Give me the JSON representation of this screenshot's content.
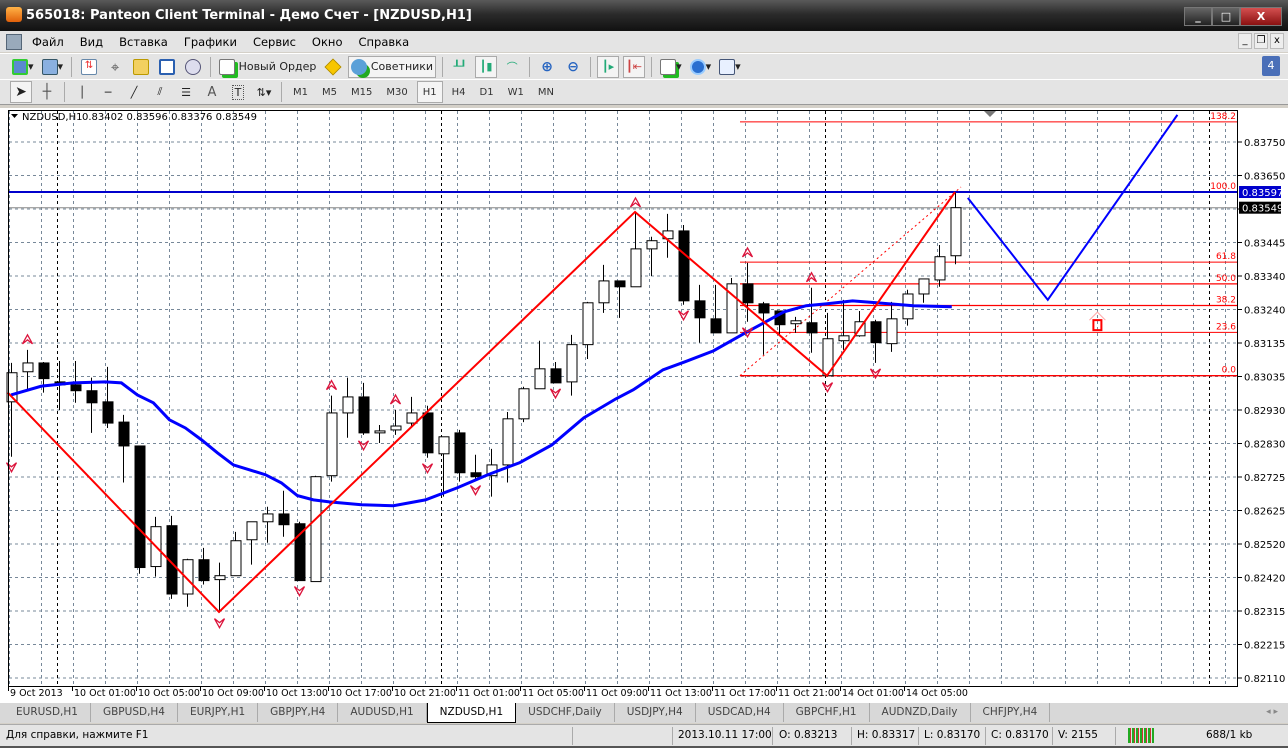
{
  "window": {
    "title": "565018: Panteon Client Terminal - Демо Счет - [NZDUSD,H1]",
    "minimize": "_",
    "maximize": "□",
    "close": "X"
  },
  "menu": [
    "Файл",
    "Вид",
    "Вставка",
    "Графики",
    "Сервис",
    "Окно",
    "Справка"
  ],
  "mdi": {
    "minimize": "_",
    "restore": "❐",
    "close": "x"
  },
  "toolbar": {
    "new_order": "Новый Ордер",
    "experts": "Советники",
    "notifications": "4"
  },
  "timeframes": [
    "M1",
    "M5",
    "M15",
    "M30",
    "H1",
    "H4",
    "D1",
    "W1",
    "MN"
  ],
  "active_timeframe": "H1",
  "chart_header": {
    "symbol": "NZDUSD,H1",
    "ohlc": "0.83402 0.83596 0.83376 0.83549"
  },
  "tabs": [
    "EURUSD,H1",
    "GBPUSD,H4",
    "EURJPY,H1",
    "GBPJPY,H4",
    "AUDUSD,H1",
    "NZDUSD,H1",
    "USDCHF,Daily",
    "USDJPY,H4",
    "USDCAD,H4",
    "GBPCHF,H1",
    "AUDNZD,Daily",
    "CHFJPY,H4"
  ],
  "active_tab": "NZDUSD,H1",
  "status": {
    "help": "Для справки, нажмите F1",
    "time": "2013.10.11 17:00",
    "open": "O: 0.83213",
    "high": "H: 0.83317",
    "low": "L: 0.83170",
    "close": "C: 0.83170",
    "volume": "V: 2155",
    "traffic": "688/1 kb"
  },
  "chart_data": {
    "type": "candlestick",
    "symbol": "NZDUSD",
    "timeframe": "H1",
    "ylim": [
      0.8211,
      0.8375
    ],
    "grid": true,
    "y_ticks": [
      "0.83750",
      "0.83650",
      "",
      "0.83445",
      "0.83340",
      "0.83240",
      "0.83135",
      "0.83035",
      "0.82930",
      "0.82830",
      "0.82725",
      "0.82625",
      "0.82520",
      "0.82420",
      "0.82315",
      "0.82215",
      "0.82110"
    ],
    "x_ticks": [
      "9 Oct 2013",
      "10 Oct 01:00",
      "10 Oct 05:00",
      "10 Oct 09:00",
      "10 Oct 13:00",
      "10 Oct 17:00",
      "10 Oct 21:00",
      "11 Oct 01:00",
      "11 Oct 05:00",
      "11 Oct 09:00",
      "11 Oct 13:00",
      "11 Oct 17:00",
      "11 Oct 21:00",
      "14 Oct 01:00",
      "14 Oct 05:00"
    ],
    "price_labels": {
      "level": "0.83597",
      "bid": "0.83549"
    },
    "colors": {
      "bull": "#ffffff",
      "bear": "#000000",
      "ma": "#0000ff",
      "zigzag": "#ff0000",
      "fractal": "#dc143c",
      "level": "#0000cc",
      "fib": "#ff0000"
    },
    "ohlc": [
      [
        0.82955,
        0.83074,
        0.82787,
        0.83044
      ],
      [
        0.83047,
        0.83114,
        0.82992,
        0.83074
      ],
      [
        0.83074,
        0.83077,
        0.82983,
        0.83026
      ],
      [
        0.83016,
        0.8308,
        0.8293,
        0.83007
      ],
      [
        0.83007,
        0.8308,
        0.82952,
        0.82989
      ],
      [
        0.82989,
        0.83029,
        0.8286,
        0.82952
      ],
      [
        0.82955,
        0.83062,
        0.82875,
        0.8289
      ],
      [
        0.82893,
        0.82915,
        0.82708,
        0.8282
      ],
      [
        0.8282,
        0.8282,
        0.82429,
        0.82448
      ],
      [
        0.82451,
        0.82603,
        0.8242,
        0.82573
      ],
      [
        0.82576,
        0.82606,
        0.82352,
        0.82367
      ],
      [
        0.82367,
        0.82475,
        0.82328,
        0.82472
      ],
      [
        0.82472,
        0.82508,
        0.82396,
        0.82408
      ],
      [
        0.82411,
        0.82463,
        0.8231,
        0.82423
      ],
      [
        0.82423,
        0.82557,
        0.82423,
        0.8253
      ],
      [
        0.82533,
        0.82588,
        0.82457,
        0.82588
      ],
      [
        0.82588,
        0.82634,
        0.82524,
        0.82612
      ],
      [
        0.82612,
        0.82683,
        0.82542,
        0.82579
      ],
      [
        0.82582,
        0.82588,
        0.82408,
        0.82408
      ],
      [
        0.82405,
        0.82729,
        0.82405,
        0.82726
      ],
      [
        0.82729,
        0.82974,
        0.82711,
        0.82921
      ],
      [
        0.82921,
        0.83029,
        0.82845,
        0.8297
      ],
      [
        0.8297,
        0.83013,
        0.82854,
        0.8286
      ],
      [
        0.8286,
        0.82884,
        0.82829,
        0.82866
      ],
      [
        0.82869,
        0.8293,
        0.82854,
        0.82881
      ],
      [
        0.8289,
        0.8297,
        0.82878,
        0.82921
      ],
      [
        0.82921,
        0.82943,
        0.82784,
        0.82799
      ],
      [
        0.82796,
        0.82848,
        0.82665,
        0.82848
      ],
      [
        0.8286,
        0.82869,
        0.82711,
        0.82738
      ],
      [
        0.82738,
        0.82793,
        0.82717,
        0.82726
      ],
      [
        0.82729,
        0.82811,
        0.82665,
        0.82762
      ],
      [
        0.82762,
        0.82924,
        0.82708,
        0.82903
      ],
      [
        0.82903,
        0.83001,
        0.82893,
        0.82995
      ],
      [
        0.82995,
        0.83142,
        0.82995,
        0.83056
      ],
      [
        0.83056,
        0.83077,
        0.83013,
        0.83013
      ],
      [
        0.83016,
        0.8316,
        0.82974,
        0.8313
      ],
      [
        0.8313,
        0.83261,
        0.83086,
        0.83258
      ],
      [
        0.83258,
        0.83374,
        0.83227,
        0.83325
      ],
      [
        0.83325,
        0.83325,
        0.83212,
        0.83307
      ],
      [
        0.83307,
        0.83533,
        0.83307,
        0.83423
      ],
      [
        0.83423,
        0.8346,
        0.8334,
        0.83448
      ],
      [
        0.83454,
        0.8353,
        0.83396,
        0.83478
      ],
      [
        0.83478,
        0.83496,
        0.83252,
        0.83264
      ],
      [
        0.83264,
        0.83313,
        0.83136,
        0.83212
      ],
      [
        0.83209,
        0.83313,
        0.83166,
        0.83166
      ],
      [
        0.83166,
        0.83334,
        0.83166,
        0.83316
      ],
      [
        0.83316,
        0.8338,
        0.832,
        0.83258
      ],
      [
        0.83255,
        0.83261,
        0.83099,
        0.83227
      ],
      [
        0.83233,
        0.83233,
        0.8316,
        0.83191
      ],
      [
        0.83194,
        0.83215,
        0.83166,
        0.83203
      ],
      [
        0.83197,
        0.83304,
        0.83105,
        0.83166
      ],
      [
        0.83035,
        0.83227,
        0.83032,
        0.83148
      ],
      [
        0.83142,
        0.83267,
        0.83114,
        0.83157
      ],
      [
        0.83157,
        0.83233,
        0.83154,
        0.832
      ],
      [
        0.832,
        0.83206,
        0.83074,
        0.83136
      ],
      [
        0.83133,
        0.83261,
        0.83108,
        0.83209
      ],
      [
        0.83209,
        0.83298,
        0.83188,
        0.83285
      ],
      [
        0.83285,
        0.83331,
        0.83258,
        0.83331
      ],
      [
        0.83328,
        0.83435,
        0.83307,
        0.83399
      ],
      [
        0.83402,
        0.83596,
        0.83376,
        0.83549
      ]
    ],
    "moving_average": [
      [
        0,
        0.82976
      ],
      [
        1.9,
        0.83003
      ],
      [
        3.9,
        0.83013
      ],
      [
        5.9,
        0.83016
      ],
      [
        6.9,
        0.83013
      ],
      [
        7.9,
        0.82976
      ],
      [
        8.9,
        0.82952
      ],
      [
        9.9,
        0.829
      ],
      [
        10.9,
        0.82875
      ],
      [
        11.9,
        0.82839
      ],
      [
        12.9,
        0.82799
      ],
      [
        13.9,
        0.82762
      ],
      [
        14.9,
        0.82747
      ],
      [
        15.9,
        0.82732
      ],
      [
        16.9,
        0.82707
      ],
      [
        17.9,
        0.82668
      ],
      [
        18.9,
        0.82655
      ],
      [
        19.9,
        0.82649
      ],
      [
        21.9,
        0.8264
      ],
      [
        23.9,
        0.82637
      ],
      [
        25.9,
        0.82655
      ],
      [
        27.9,
        0.82692
      ],
      [
        29.8,
        0.82732
      ],
      [
        31.8,
        0.82769
      ],
      [
        33.8,
        0.82823
      ],
      [
        35.8,
        0.82906
      ],
      [
        37.8,
        0.82964
      ],
      [
        38.9,
        0.82992
      ],
      [
        40.75,
        0.83053
      ],
      [
        42.1,
        0.83077
      ],
      [
        43.9,
        0.83111
      ],
      [
        45.9,
        0.83166
      ],
      [
        48.3,
        0.8323
      ],
      [
        49.7,
        0.83249
      ],
      [
        51,
        0.83255
      ],
      [
        52.6,
        0.83264
      ],
      [
        54.1,
        0.83258
      ],
      [
        56.4,
        0.83249
      ],
      [
        58.8,
        0.83246
      ]
    ],
    "zigzag": [
      [
        -0.2,
        0.82983
      ],
      [
        13,
        0.82312
      ],
      [
        39,
        0.83536
      ],
      [
        51,
        0.83035
      ],
      [
        59,
        0.83597
      ]
    ],
    "projection": [
      [
        59.8,
        0.83579
      ],
      [
        64.8,
        0.83267
      ],
      [
        72.9,
        0.83833
      ]
    ],
    "fractals_up": [
      1,
      20,
      24,
      39,
      46,
      50
    ],
    "fractals_down": [
      0,
      13,
      18,
      22,
      26,
      29,
      34,
      42,
      46,
      51,
      54
    ],
    "horizontal_level": 0.83597,
    "bid_line": 0.83549,
    "fibonacci": {
      "start_bar": 46,
      "low": 0.83035,
      "high": 0.83597,
      "levels": [
        {
          "label": "0.0",
          "ratio": 0
        },
        {
          "label": "23.6",
          "ratio": 0.236
        },
        {
          "label": "38.2",
          "ratio": 0.382
        },
        {
          "label": "50.0",
          "ratio": 0.5
        },
        {
          "label": "61.8",
          "ratio": 0.618
        },
        {
          "label": "100.0",
          "ratio": 1
        },
        {
          "label": "138.2",
          "ratio": 1.382
        }
      ]
    },
    "signal_arrow": {
      "bar": 67.9,
      "price": 0.83205
    }
  }
}
